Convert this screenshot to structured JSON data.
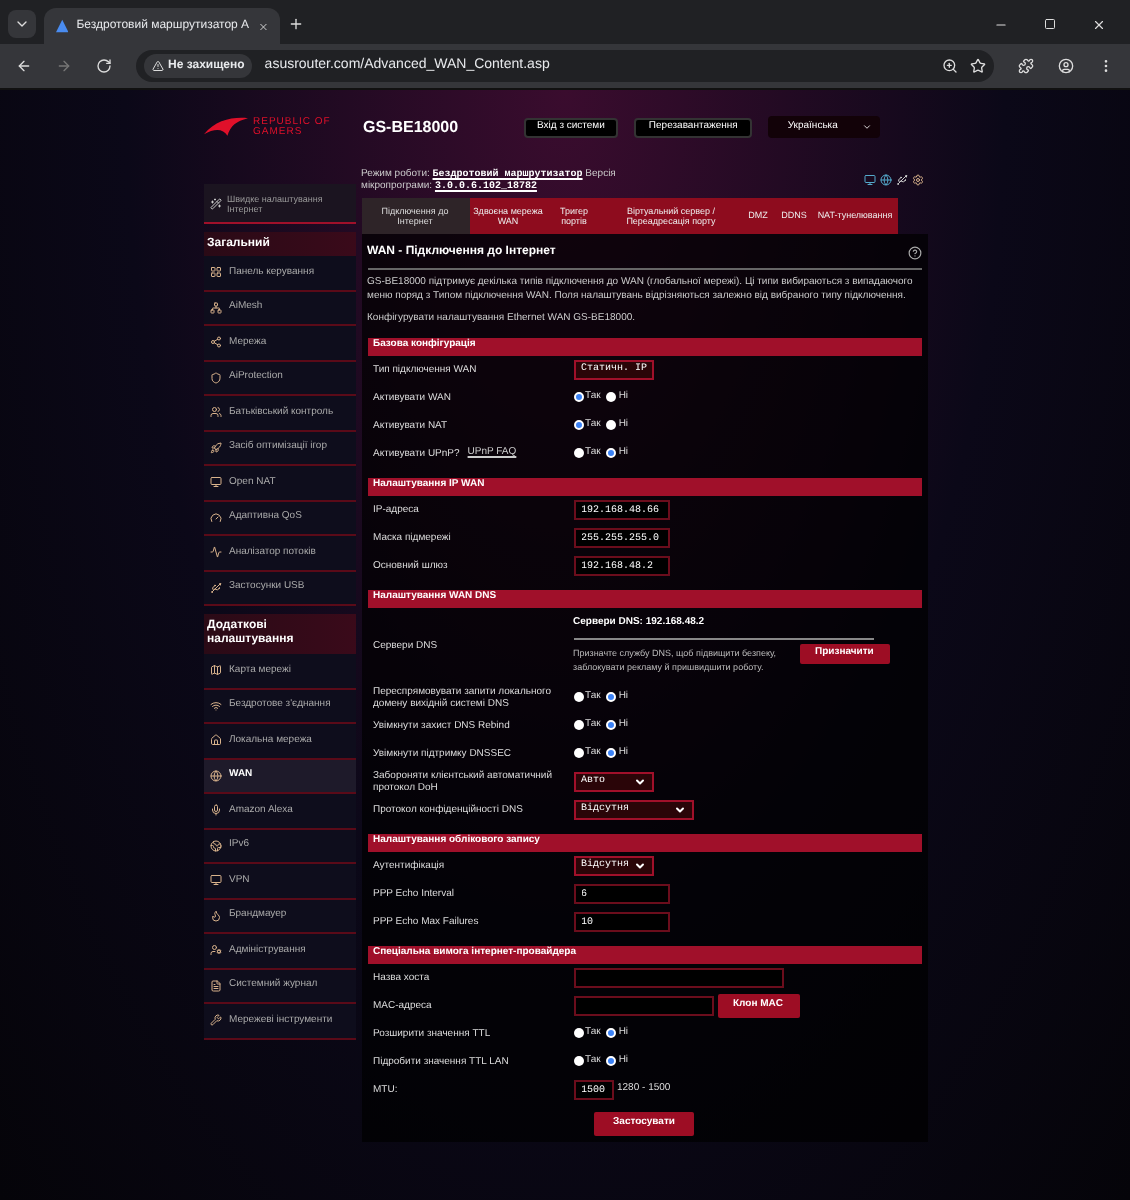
{
  "browser": {
    "tab_title": "Бездротовий маршрутизатор А",
    "security": "Не захищено",
    "url": "asusrouter.com/Advanced_WAN_Content.asp"
  },
  "header": {
    "brand": [
      "REPUBLIC OF",
      "GAMERS"
    ],
    "model": "GS-BE18000",
    "buttons": [
      "Вхід з системи",
      "Перезавантаження"
    ],
    "language": "Українська"
  },
  "sidebar": {
    "quick_setup": "Швидке налаштування Інтернет",
    "sections": [
      {
        "title": "Загальний",
        "items": [
          {
            "label": "Панель керування",
            "selected": false
          },
          {
            "label": "AiMesh",
            "selected": false
          },
          {
            "label": "Мережа",
            "selected": false
          },
          {
            "label": "AiProtection",
            "selected": false
          },
          {
            "label": "Батьківський контроль",
            "selected": false
          },
          {
            "label": "Засіб оптимізації ігор",
            "selected": false
          },
          {
            "label": "Open NAT",
            "selected": false
          },
          {
            "label": "Адаптивна QoS",
            "selected": false
          },
          {
            "label": "Аналізатор потоків",
            "selected": false
          },
          {
            "label": "Застосунки USB",
            "selected": false
          }
        ]
      },
      {
        "title": "Додаткові налаштування",
        "items": [
          {
            "label": "Карта мережі",
            "selected": false
          },
          {
            "label": "Бездротове з'єднання",
            "selected": false
          },
          {
            "label": "Локальна мережа",
            "selected": false
          },
          {
            "label": "WAN",
            "selected": true
          },
          {
            "label": "Amazon Alexa",
            "selected": false
          },
          {
            "label": "IPv6",
            "selected": false
          },
          {
            "label": "VPN",
            "selected": false
          },
          {
            "label": "Брандмауер",
            "selected": false
          },
          {
            "label": "Адміністрування",
            "selected": false
          },
          {
            "label": "Системний журнал",
            "selected": false
          },
          {
            "label": "Мережеві інструменти",
            "selected": false
          }
        ]
      }
    ]
  },
  "op_mode": {
    "label": "Режим роботи:",
    "mode": "Бездротовий маршрутизатор",
    "firmware_label": "Версія мікропрограми:",
    "firmware": "3.0.0.6.102_18782"
  },
  "tabs": [
    {
      "label": "Підключення до Інтернет",
      "selected": true
    },
    {
      "label": "Здвоєна мережа WAN",
      "selected": false
    },
    {
      "label": "Тригер портів",
      "selected": false
    },
    {
      "label": "Віртуальний сервер / Переадресація порту",
      "selected": false
    },
    {
      "label": "DMZ",
      "selected": false
    },
    {
      "label": "DDNS",
      "selected": false
    },
    {
      "label": "NAT-тунелювання",
      "selected": false
    }
  ],
  "title": "WAN - Підключення до Інтернет",
  "description": "GS-BE18000 підтримує декілька типів підключення до WAN (глобальної мережі). Ці типи вибираються з випадаючого меню поряд з Типом підключення WAN. Поля налаштувань відрізняються залежно від вибраного типу підключення.",
  "configure_text": "Конфігурувати налаштування Ethernet WAN GS-BE18000.",
  "sections": [
    {
      "title": "Базова конфігурація",
      "rows": [
        {
          "kind": "select",
          "label": "Тип підключення WAN",
          "value": "Статичн. IP",
          "wide": false
        },
        {
          "kind": "radio",
          "label": "Активувати WAN",
          "options": [
            {
              "label": "Так",
              "selected": true
            },
            {
              "label": "Ні",
              "selected": false
            }
          ]
        },
        {
          "kind": "radio",
          "label": "Активувати NAT",
          "options": [
            {
              "label": "Так",
              "selected": true
            },
            {
              "label": "Ні",
              "selected": false
            }
          ]
        },
        {
          "kind": "radio",
          "label": "Активувати UPnP?",
          "link": "UPnP  FAQ",
          "options": [
            {
              "label": "Так",
              "selected": false
            },
            {
              "label": "Ні",
              "selected": true
            }
          ]
        }
      ]
    },
    {
      "title": "Налаштування IP WAN",
      "rows": [
        {
          "kind": "input",
          "label": "IP-адреса",
          "value": "192.168.48.66"
        },
        {
          "kind": "input",
          "label": "Маска підмережі",
          "value": "255.255.255.0"
        },
        {
          "kind": "input",
          "label": "Основний шлюз",
          "value": "192.168.48.2"
        }
      ]
    },
    {
      "title": "Налаштування WAN DNS",
      "rows": [
        {
          "kind": "dns",
          "label": "Сервери DNS",
          "servers": "Сервери DNS: 192.168.48.2",
          "text": "Призначте службу DNS, щоб підвищити безпеку, заблокувати рекламу й пришвидшити роботу.",
          "button": "Призначити"
        },
        {
          "kind": "radio",
          "label": "Переспрямовувати запити локального домену вихідній системі DNS",
          "options": [
            {
              "label": "Так",
              "selected": false
            },
            {
              "label": "Ні",
              "selected": true
            }
          ]
        },
        {
          "kind": "radio",
          "label": "Увімкнути захист DNS Rebind",
          "options": [
            {
              "label": "Так",
              "selected": false
            },
            {
              "label": "Ні",
              "selected": true
            }
          ]
        },
        {
          "kind": "radio",
          "label": "Увімкнути підтримку DNSSEC",
          "options": [
            {
              "label": "Так",
              "selected": false
            },
            {
              "label": "Ні",
              "selected": true
            }
          ]
        },
        {
          "kind": "select",
          "label": "Забороняти клієнтський автоматичний протокол DoH",
          "value": "Авто",
          "wide": false
        },
        {
          "kind": "select",
          "label": "Протокол конфіденційності DNS",
          "value": "Відсутня",
          "wide": true
        }
      ]
    },
    {
      "title": "Налаштування облікового запису",
      "rows": [
        {
          "kind": "select",
          "label": "Аутентифікація",
          "value": "Відсутня",
          "wide": false
        },
        {
          "kind": "input",
          "label": "PPP Echo Interval",
          "value": "6"
        },
        {
          "kind": "input",
          "label": "PPP Echo Max Failures",
          "value": "10"
        }
      ]
    },
    {
      "title": "Спеціальна вимога інтернет-провайдера",
      "rows": [
        {
          "kind": "input_wide",
          "label": "Назва хоста"
        },
        {
          "kind": "input_button",
          "label": "MAC-адреса",
          "button": "Клон MAC"
        },
        {
          "kind": "radio",
          "label": "Розширити значення TTL",
          "options": [
            {
              "label": "Так",
              "selected": false
            },
            {
              "label": "Ні",
              "selected": true
            }
          ]
        },
        {
          "kind": "radio",
          "label": "Підробити значення TTL LAN",
          "options": [
            {
              "label": "Так",
              "selected": false
            },
            {
              "label": "Ні",
              "selected": true
            }
          ]
        },
        {
          "kind": "input_hint",
          "label": "MTU:",
          "value": "1500",
          "hint": "1280 - 1500"
        }
      ]
    }
  ],
  "apply": "Застосувати"
}
